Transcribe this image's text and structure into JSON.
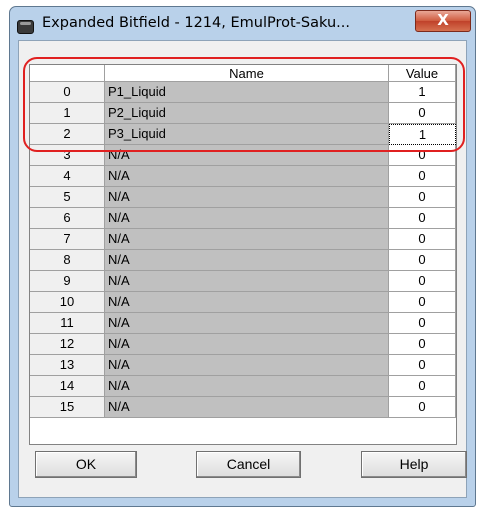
{
  "window": {
    "title": "Expanded Bitfield - 1214, EmulProt-Saku...",
    "close_label": "X"
  },
  "grid": {
    "headers": [
      "",
      "Name",
      "Value"
    ],
    "rows": [
      {
        "index": "0",
        "name": "P1_Liquid",
        "value": "1"
      },
      {
        "index": "1",
        "name": "P2_Liquid",
        "value": "0"
      },
      {
        "index": "2",
        "name": "P3_Liquid",
        "value": "1"
      },
      {
        "index": "3",
        "name": "N/A",
        "value": "0"
      },
      {
        "index": "4",
        "name": "N/A",
        "value": "0"
      },
      {
        "index": "5",
        "name": "N/A",
        "value": "0"
      },
      {
        "index": "6",
        "name": "N/A",
        "value": "0"
      },
      {
        "index": "7",
        "name": "N/A",
        "value": "0"
      },
      {
        "index": "8",
        "name": "N/A",
        "value": "0"
      },
      {
        "index": "9",
        "name": "N/A",
        "value": "0"
      },
      {
        "index": "10",
        "name": "N/A",
        "value": "0"
      },
      {
        "index": "11",
        "name": "N/A",
        "value": "0"
      },
      {
        "index": "12",
        "name": "N/A",
        "value": "0"
      },
      {
        "index": "13",
        "name": "N/A",
        "value": "0"
      },
      {
        "index": "14",
        "name": "N/A",
        "value": "0"
      },
      {
        "index": "15",
        "name": "N/A",
        "value": "0"
      }
    ]
  },
  "buttons": {
    "ok": "OK",
    "cancel": "Cancel",
    "help": "Help"
  },
  "colors": {
    "name_cell_bg": "#c0c0c0",
    "highlight": "#e02020"
  }
}
